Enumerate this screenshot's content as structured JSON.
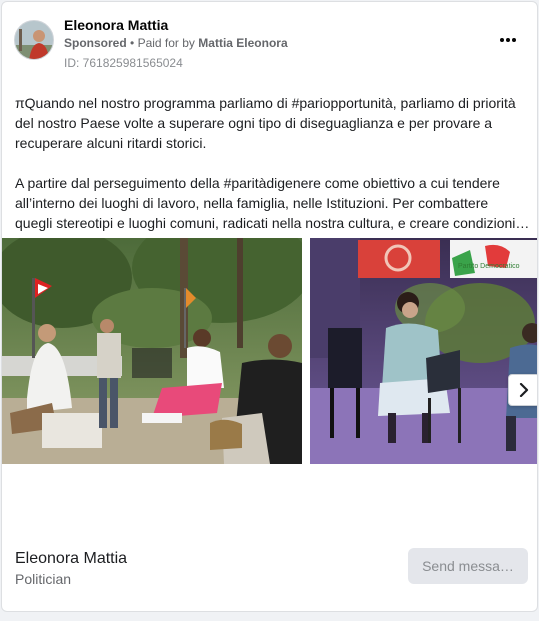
{
  "ad": {
    "page_name": "Eleonora Mattia",
    "sponsored_label": "Sponsored",
    "separator": "•",
    "paid_for_prefix": "Paid for by",
    "paid_for_name": "Mattia Eleonora",
    "id_label": "ID: 761825981565024",
    "more_icon": "more-horizontal-icon"
  },
  "body": {
    "paragraph_1": "πQuando nel nostro programma parliamo di #pariopportunità, parliamo di priorità del nostro Paese volte a superare ogni tipo di diseguaglianza e per provare a recuperare alcuni ritardi storici.",
    "paragraph_2_line_1": "A partire dal perseguimento della #paritàdigenere come obiettivo a cui tendere",
    "paragraph_2_line_2": "all’interno dei luoghi di lavoro, nella famiglia, nelle Istituzioni. Per combattere",
    "paragraph_2_line_3": "quegli stereotipi e luoghi comuni, radicati nella nostra cultura, e creare condizioni…"
  },
  "carousel": {
    "next_icon": "chevron-right-icon",
    "slide_2_sign_text": "Partito Democratico"
  },
  "footer": {
    "name": "Eleonora Mattia",
    "category": "Politician",
    "cta_label": "Send messa…"
  },
  "colors": {
    "text_primary": "#1c1e21",
    "text_secondary": "#65676b",
    "cta_bg": "#e4e6eb",
    "cta_text": "#8a8d91"
  }
}
